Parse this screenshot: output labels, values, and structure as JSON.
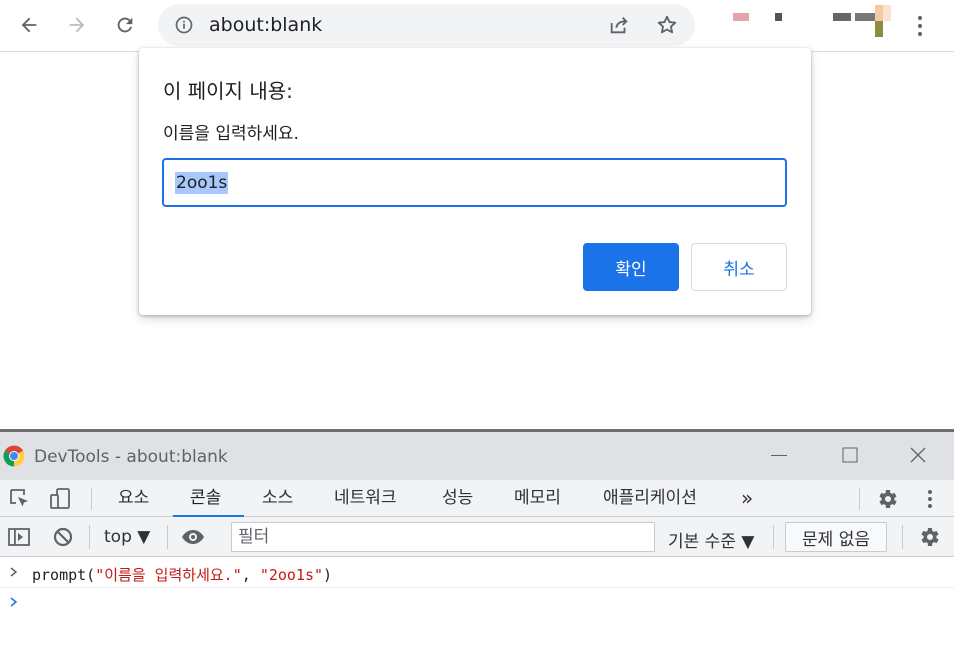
{
  "browser": {
    "url": "about:blank",
    "icons": [
      "back-arrow-icon",
      "forward-arrow-icon",
      "reload-icon",
      "info-icon",
      "share-icon",
      "star-icon",
      "menu-dots-icon"
    ]
  },
  "dialog": {
    "title": "이 페이지 내용:",
    "message": "이름을 입력하세요.",
    "input_value": "2oo1s",
    "ok_label": "확인",
    "cancel_label": "취소"
  },
  "devtools": {
    "window_title": "DevTools - about:blank",
    "tabs": [
      {
        "label": "요소",
        "active": false
      },
      {
        "label": "콘솔",
        "active": true
      },
      {
        "label": "소스",
        "active": false
      },
      {
        "label": "네트워크",
        "active": false
      },
      {
        "label": "성능",
        "active": false
      },
      {
        "label": "메모리",
        "active": false
      },
      {
        "label": "애플리케이션",
        "active": false
      }
    ],
    "more_tabs": "»",
    "context": "top ▼",
    "filter_placeholder": "필터",
    "levels": "기본 수준 ▼",
    "issues": "문제 없음",
    "console": {
      "call": "prompt(",
      "arg1": "\"이름을 입력하세요.\"",
      "comma": ", ",
      "arg2": "\"2oo1s\"",
      "close": ")"
    }
  },
  "colors": {
    "accent": "#1a73e8",
    "selection": "#a8c7fa",
    "console_string": "#c41a16"
  }
}
